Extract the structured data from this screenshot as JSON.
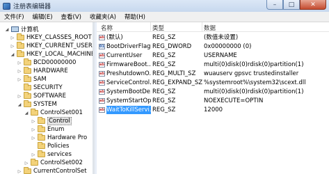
{
  "window": {
    "title": "注册表编辑器",
    "min": "–",
    "max": "□",
    "close": "✕"
  },
  "menu": [
    "文件(F)",
    "编辑(E)",
    "查看(V)",
    "收藏夹(A)",
    "帮助(H)"
  ],
  "tree": [
    {
      "label": "计算机",
      "icon": "pc-icon",
      "expander": "◢"
    },
    {
      "label": "HKEY_CLASSES_ROOT",
      "icon": "folder-icon",
      "expander": "▷"
    },
    {
      "label": "HKEY_CURRENT_USER",
      "icon": "folder-icon",
      "expander": "▷"
    },
    {
      "label": "HKEY_LOCAL_MACHINE",
      "icon": "folder-icon",
      "expander": "◢"
    },
    {
      "label": "BCD00000000",
      "icon": "folder-icon",
      "expander": "▷"
    },
    {
      "label": "HARDWARE",
      "icon": "folder-icon",
      "expander": "▷"
    },
    {
      "label": "SAM",
      "icon": "folder-icon",
      "expander": "▷"
    },
    {
      "label": "SECURITY",
      "icon": "folder-icon",
      "expander": ""
    },
    {
      "label": "SOFTWARE",
      "icon": "folder-icon",
      "expander": "▷"
    },
    {
      "label": "SYSTEM",
      "icon": "folder-icon",
      "expander": "◢"
    },
    {
      "label": "ControlSet001",
      "icon": "folder-icon",
      "expander": "◢"
    },
    {
      "label": "Control",
      "icon": "folder-icon",
      "expander": "▷",
      "selected": true
    },
    {
      "label": "Enum",
      "icon": "folder-icon",
      "expander": "▷"
    },
    {
      "label": "Hardware Pro",
      "icon": "folder-icon",
      "expander": "▷"
    },
    {
      "label": "Policies",
      "icon": "folder-icon",
      "expander": ""
    },
    {
      "label": "services",
      "icon": "folder-icon",
      "expander": "▷"
    },
    {
      "label": "ControlSet002",
      "icon": "folder-icon",
      "expander": "▷"
    },
    {
      "label": "CurrentControlSet",
      "icon": "folder-icon",
      "expander": "▷"
    }
  ],
  "columns": {
    "name": "名称",
    "type": "类型",
    "data": "数据"
  },
  "values": [
    {
      "name": "(默认)",
      "type": "REG_SZ",
      "data": "(数值未设置)",
      "icon": "sz"
    },
    {
      "name": "BootDriverFlags",
      "type": "REG_DWORD",
      "data": "0x00000000 (0)",
      "icon": "bin"
    },
    {
      "name": "CurrentUser",
      "type": "REG_SZ",
      "data": "USERNAME",
      "icon": "sz"
    },
    {
      "name": "FirmwareBoot...",
      "type": "REG_SZ",
      "data": "multi(0)disk(0)rdisk(0)partition(1)",
      "icon": "sz"
    },
    {
      "name": "PreshutdownO...",
      "type": "REG_MULTI_SZ",
      "data": "wuauserv gpsvc trustedinstaller",
      "icon": "sz"
    },
    {
      "name": "ServiceControl...",
      "type": "REG_EXPAND_SZ",
      "data": "%systemroot%\\system32\\scext.dll",
      "icon": "sz"
    },
    {
      "name": "SystemBootDe...",
      "type": "REG_SZ",
      "data": "multi(0)disk(0)rdisk(0)partition(1)",
      "icon": "sz"
    },
    {
      "name": "SystemStartOp...",
      "type": "REG_SZ",
      "data": " NOEXECUTE=OPTIN",
      "icon": "sz"
    },
    {
      "name": "WaitToKillServi...",
      "type": "REG_SZ",
      "data": "12000",
      "icon": "sz",
      "selected": true
    }
  ]
}
